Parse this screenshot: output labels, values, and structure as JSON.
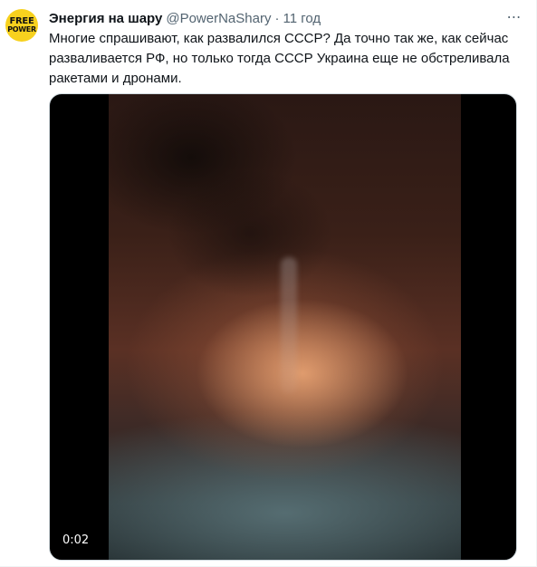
{
  "tweet": {
    "avatar_line1": "FREE",
    "avatar_line2": "POWER",
    "display_name": "Энергия на шару",
    "handle": "@PowerNaShary",
    "separator": "·",
    "time": "11 год",
    "more_icon": "⋯",
    "text": "Многие спрашивают, как развалился СССР? Да точно так же, как сейчас разваливается РФ, но только тогда СССР Украина еще не обстреливала ракетами и дронами."
  },
  "media": {
    "duration": "0:02"
  },
  "colors": {
    "avatar_bg": "#f7d11e",
    "text": "#0f1419",
    "secondary_text": "#536471",
    "media_border": "#cfd9de"
  }
}
